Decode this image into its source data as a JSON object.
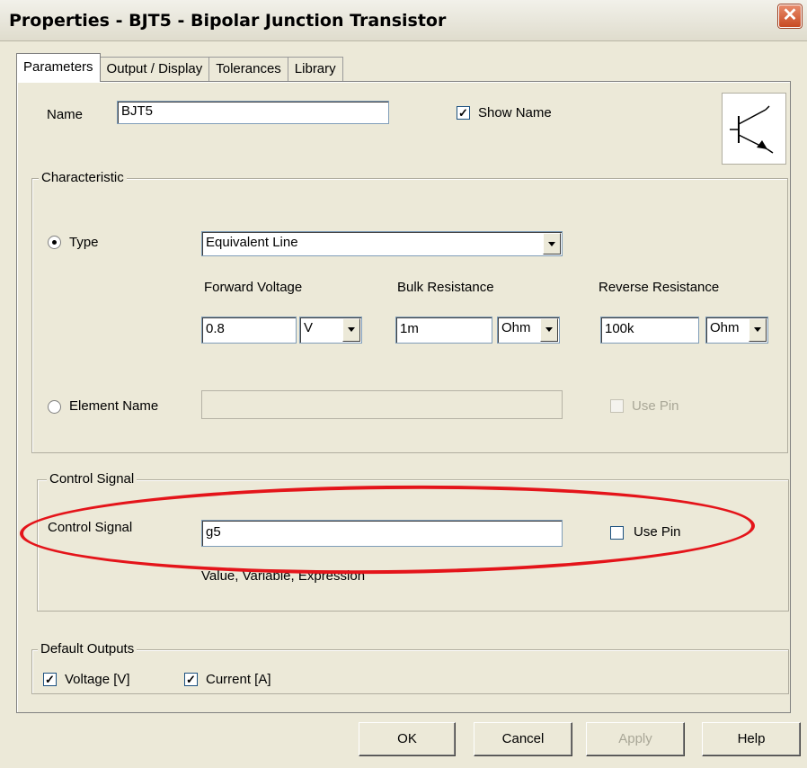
{
  "window": {
    "title": "Properties - BJT5 - Bipolar Junction Transistor",
    "close_icon": "close-icon"
  },
  "tabs": [
    {
      "label": "Parameters",
      "active": true
    },
    {
      "label": "Output / Display",
      "active": false
    },
    {
      "label": "Tolerances",
      "active": false
    },
    {
      "label": "Library",
      "active": false
    }
  ],
  "name": {
    "label": "Name",
    "value": "BJT5",
    "show_name_label": "Show Name",
    "show_name_checked": true
  },
  "symbol_icon": "bjt-transistor-icon",
  "characteristic": {
    "group_title": "Characteristic",
    "type_label": "Type",
    "type_selected": true,
    "type_value": "Equivalent Line",
    "forward_voltage": {
      "label": "Forward Voltage",
      "value": "0.8",
      "unit": "V"
    },
    "bulk_resistance": {
      "label": "Bulk Resistance",
      "value": "1m",
      "unit": "Ohm"
    },
    "reverse_resistance": {
      "label": "Reverse Resistance",
      "value": "100k",
      "unit": "Ohm"
    },
    "element_name_label": "Element Name",
    "element_name_value": "",
    "use_pin_label": "Use Pin"
  },
  "control_signal": {
    "group_title": "Control Signal",
    "label": "Control Signal",
    "value": "g5",
    "use_pin_label": "Use Pin",
    "hint": "Value, Variable, Expression"
  },
  "default_outputs": {
    "group_title": "Default Outputs",
    "voltage_label": "Voltage [V]",
    "current_label": "Current [A]"
  },
  "buttons": {
    "ok": "OK",
    "cancel": "Cancel",
    "apply": "Apply",
    "help": "Help"
  },
  "colors": {
    "annotation": "#e4141a",
    "dialog_bg": "#ece9d8"
  }
}
